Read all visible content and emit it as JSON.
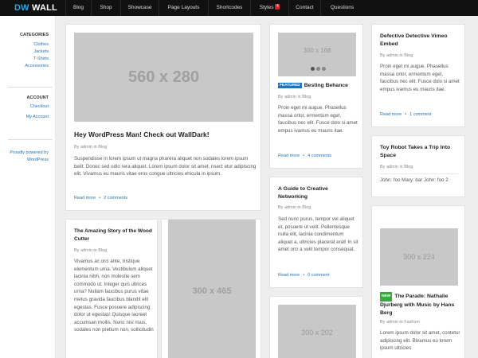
{
  "brand": {
    "prefix": "DW",
    "name": "WALL"
  },
  "nav": [
    {
      "label": "Blog"
    },
    {
      "label": "Shop"
    },
    {
      "label": "Showcase"
    },
    {
      "label": "Page Layouts"
    },
    {
      "label": "Shortcodes"
    },
    {
      "label": "Styles",
      "badge": "4"
    },
    {
      "label": "Contact"
    },
    {
      "label": "Questions"
    }
  ],
  "sidebar": {
    "categories_title": "CATEGORIES",
    "categories": [
      "Clothes",
      "Jackets",
      "T-Shirts",
      "Accessories"
    ],
    "account_title": "ACCOUNT",
    "account": [
      "Checkout",
      "My Account"
    ],
    "powered": "Proudly powered by WordPress"
  },
  "posts": {
    "hey": {
      "image": "560 x 280",
      "title": "Hey WordPress Man! Check out WallDark!",
      "meta": "By admin in Blog",
      "text": "Suspendisse in lorem ipsum ut magna pharera aliquet non sodales lorem ipsum belit. Donec sed odio rera aliquet. Lorem ipsum dolor sit amet, nsect etur adipiscing elit. Vivamus eu mauris vitae eros congue ultricies ehicula in ipsum.",
      "read_more": "Read more",
      "comments": "2 comments"
    },
    "behance": {
      "image": "300 x 168",
      "badge": "FEATURED",
      "title": "Besting Behance",
      "meta": "By admin in Blog",
      "text": "Proin eget mi augue. Phasellus massa ortor, ermentum eget, faucibus nec elit. Fusce dolo si amet empus ivamus eu mauris itae.",
      "read_more": "Read more",
      "comments": "4 comments"
    },
    "guide": {
      "title": "A Guide to Creative Networking",
      "meta": "By admin in Blog",
      "text": "Sed nunc purus, tempor vel aliquet et, posuere ut velit. Pellentesque nulla elit, lacinia condimentum aliquet a, ultricies placerat erat! In sit amet orci a velit tempor consequat.",
      "read_more": "Read more",
      "comments": "0 comment"
    },
    "small": {
      "image": "300 x 202"
    },
    "vimeo": {
      "title": "Defective Detective Vimeo Embed",
      "meta": "By admin in Blog",
      "text": "Proin eget mi augue. Phasellus massa ortor, ermentum eget, faucibus nec elit. Fusce dolo si amet empus ivamus eu mauris itae.",
      "read_more": "Read more",
      "comments": "1 comment"
    },
    "toy": {
      "title": "Toy Robot Takes a Trip Into Space",
      "meta": "By admin in Blog",
      "text": "John: foo Mary: bar John: foo 2"
    },
    "wood": {
      "title": "The Amazing Story of the Wood Cutter",
      "meta": "By admin in Blog",
      "text": "Vivamus ac orci ante, tristique elementum urna. Vestibulum aliquet lacinia nibh, non molestie sem commodo ut. Integer quis ultrices urna? Nullam faucibus purus vitae metus gravida faucibus blandit elit egestas. Fusce posuere adipiscing dolor ut egestas! Quisque laoreet accumsan mollis. Nunc nisl risus, sodales non pretium non, sollicitudin"
    },
    "tall": {
      "image": "300 x 465"
    },
    "parade": {
      "image": "300 x 224",
      "badge": "NEW",
      "title": "The Parade: Nathalie Djurberg with Music by Hans Berg",
      "meta": "By admin in Fashion",
      "text": "Lorem ipsum dolor sit amet, contetur adipiscing elit. Bivamus eu lorem ipsum ultricies"
    }
  },
  "colors": {
    "link": "#1e73be",
    "accent": "#29a6e0",
    "featured": "#1e73be",
    "new": "#3aa83a",
    "nav_badge": "#d9222a"
  }
}
